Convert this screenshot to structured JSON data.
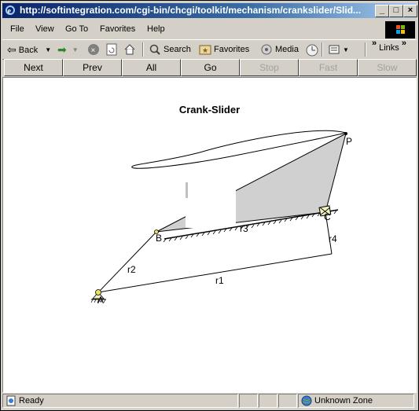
{
  "window": {
    "title": "http://softintegration.com/cgi-bin/chcgi/toolkit/mechanism/crankslider/Slid..."
  },
  "menu": [
    "File",
    "View",
    "Go To",
    "Favorites",
    "Help"
  ],
  "toolbar": {
    "back": "Back",
    "search": "Search",
    "favorites": "Favorites",
    "media": "Media",
    "links": "Links"
  },
  "nav": {
    "next": "Next",
    "prev": "Prev",
    "all": "All",
    "go": "Go",
    "stop": "Stop",
    "fast": "Fast",
    "slow": "Slow"
  },
  "diagram": {
    "title": "Crank-Slider",
    "labels": {
      "P": "P",
      "B": "B",
      "C": "C",
      "A": "A",
      "r1": "r1",
      "r2": "r2",
      "r3": "r3",
      "r4": "r4"
    }
  },
  "status": {
    "text": "Ready",
    "zone": "Unknown Zone"
  },
  "colors": {
    "titlebar_start": "#0a246a",
    "titlebar_end": "#a6caf0",
    "chrome": "#d4d0c8",
    "coupler_fill": "#d0d0d0"
  }
}
